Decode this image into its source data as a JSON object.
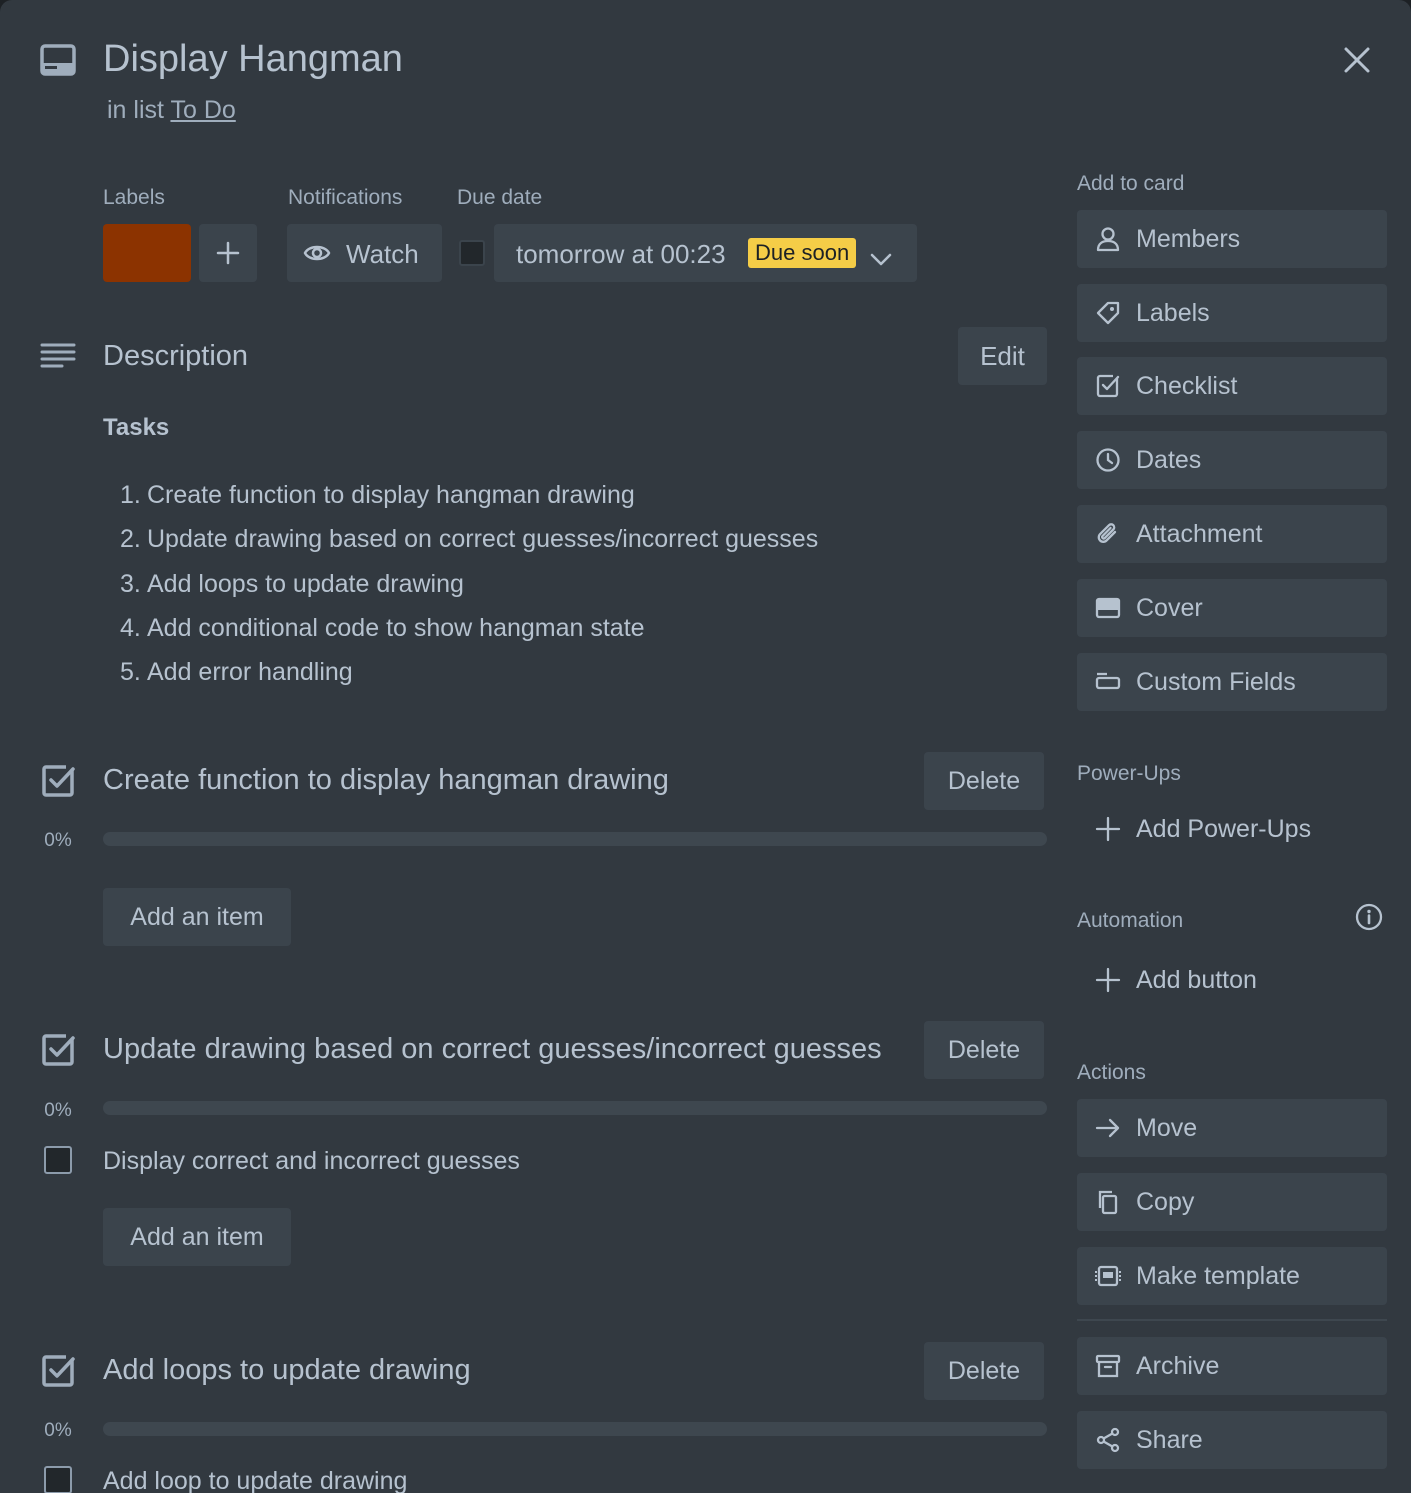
{
  "card": {
    "title": "Display Hangman",
    "list_prefix": "in list",
    "list_name": "To Do"
  },
  "labels": {
    "heading": "Labels",
    "color": "#8c3300",
    "add_label": "+"
  },
  "notifications": {
    "heading": "Notifications",
    "watch_label": "Watch"
  },
  "due_date": {
    "heading": "Due date",
    "value": "tomorrow at 00:23",
    "badge": "Due soon",
    "badge_color": "#f5cd47",
    "checked": false
  },
  "description": {
    "heading": "Description",
    "edit_label": "Edit",
    "subheading": "Tasks",
    "tasks": [
      {
        "num": "1.",
        "text": "Create function to display hangman drawing"
      },
      {
        "num": "2.",
        "text": "Update drawing based on correct guesses/incorrect guesses"
      },
      {
        "num": "3.",
        "text": "Add loops to update drawing"
      },
      {
        "num": "4.",
        "text": "Add conditional code to show hangman state"
      },
      {
        "num": "5.",
        "text": "Add error handling"
      }
    ]
  },
  "checklists": [
    {
      "title": "Create function to display hangman drawing",
      "delete_label": "Delete",
      "percent": "0%",
      "progress": 0,
      "items": [],
      "add_item_label": "Add an item"
    },
    {
      "title": "Update drawing based on correct guesses/incorrect guesses",
      "delete_label": "Delete",
      "percent": "0%",
      "progress": 0,
      "items": [
        {
          "text": "Display correct and incorrect guesses",
          "checked": false
        }
      ],
      "add_item_label": "Add an item"
    },
    {
      "title": "Add loops to update drawing",
      "delete_label": "Delete",
      "percent": "0%",
      "progress": 0,
      "items": [
        {
          "text": "Add loop to update drawing",
          "checked": false
        }
      ]
    }
  ],
  "sidebar": {
    "add_to_card": {
      "heading": "Add to card",
      "items": [
        {
          "label": "Members",
          "icon": "person-icon"
        },
        {
          "label": "Labels",
          "icon": "tag-icon"
        },
        {
          "label": "Checklist",
          "icon": "checklist-icon"
        },
        {
          "label": "Dates",
          "icon": "clock-icon"
        },
        {
          "label": "Attachment",
          "icon": "paperclip-icon"
        },
        {
          "label": "Cover",
          "icon": "cover-icon"
        },
        {
          "label": "Custom Fields",
          "icon": "custom-fields-icon"
        }
      ]
    },
    "power_ups": {
      "heading": "Power-Ups",
      "add_label": "Add Power-Ups"
    },
    "automation": {
      "heading": "Automation",
      "add_label": "Add button"
    },
    "actions": {
      "heading": "Actions",
      "items": [
        {
          "label": "Move",
          "icon": "arrow-right-icon"
        },
        {
          "label": "Copy",
          "icon": "copy-icon"
        },
        {
          "label": "Make template",
          "icon": "template-icon"
        },
        {
          "label": "Archive",
          "icon": "archive-icon"
        },
        {
          "label": "Share",
          "icon": "share-icon"
        }
      ]
    }
  }
}
